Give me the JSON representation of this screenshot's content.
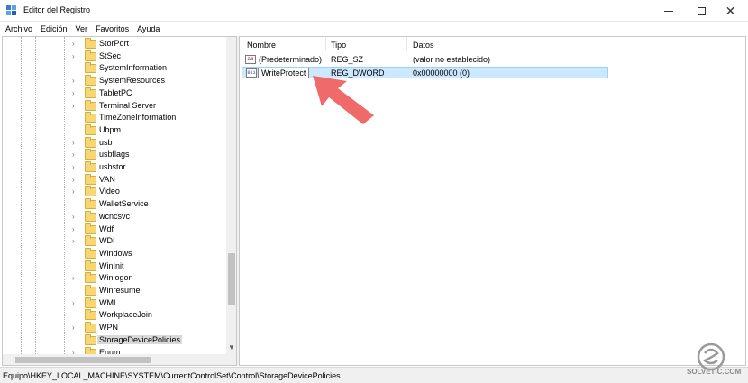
{
  "window": {
    "title": "Editor del Registro",
    "controls": [
      "minimize-icon",
      "maximize-icon",
      "close-icon"
    ]
  },
  "menu": [
    "Archivo",
    "Edición",
    "Ver",
    "Favoritos",
    "Ayuda"
  ],
  "tree": {
    "items": [
      {
        "label": "StorPort",
        "expandable": true
      },
      {
        "label": "StSec",
        "expandable": true
      },
      {
        "label": "SystemInformation",
        "expandable": false
      },
      {
        "label": "SystemResources",
        "expandable": true
      },
      {
        "label": "TabletPC",
        "expandable": true
      },
      {
        "label": "Terminal Server",
        "expandable": true
      },
      {
        "label": "TimeZoneInformation",
        "expandable": false
      },
      {
        "label": "Ubpm",
        "expandable": false
      },
      {
        "label": "usb",
        "expandable": true
      },
      {
        "label": "usbflags",
        "expandable": true
      },
      {
        "label": "usbstor",
        "expandable": true
      },
      {
        "label": "VAN",
        "expandable": true
      },
      {
        "label": "Video",
        "expandable": true
      },
      {
        "label": "WalletService",
        "expandable": false
      },
      {
        "label": "wcncsvc",
        "expandable": true
      },
      {
        "label": "Wdf",
        "expandable": true
      },
      {
        "label": "WDI",
        "expandable": true
      },
      {
        "label": "Windows",
        "expandable": false
      },
      {
        "label": "WinInit",
        "expandable": false
      },
      {
        "label": "Winlogon",
        "expandable": true
      },
      {
        "label": "Winresume",
        "expandable": false
      },
      {
        "label": "WMI",
        "expandable": true
      },
      {
        "label": "WorkplaceJoin",
        "expandable": false
      },
      {
        "label": "WPN",
        "expandable": true
      },
      {
        "label": "StorageDevicePolicies",
        "expandable": false,
        "selected": true
      },
      {
        "label": "Enum",
        "expandable": true
      }
    ]
  },
  "list": {
    "columns": [
      "Nombre",
      "Tipo",
      "Datos"
    ],
    "rows": [
      {
        "icon": "string-value-icon",
        "name": "(Predeterminado)",
        "type": "REG_SZ",
        "data": "(valor no establecido)",
        "selected": false
      },
      {
        "icon": "binary-value-icon",
        "name": "WriteProtect",
        "type": "REG_DWORD",
        "data": "0x00000000 (0)",
        "selected": true
      }
    ]
  },
  "status": {
    "path": "Equipo\\HKEY_LOCAL_MACHINE\\SYSTEM\\CurrentControlSet\\Control\\StorageDevicePolicies"
  },
  "annotation": {
    "icon": "pointer-arrow-icon",
    "color": "#f06a6a"
  },
  "watermark": {
    "text": "SOLVETIC.COM"
  },
  "colors": {
    "selection": "#cce8ff",
    "selection_border": "#99d1ff",
    "folder": "#f7d774"
  }
}
